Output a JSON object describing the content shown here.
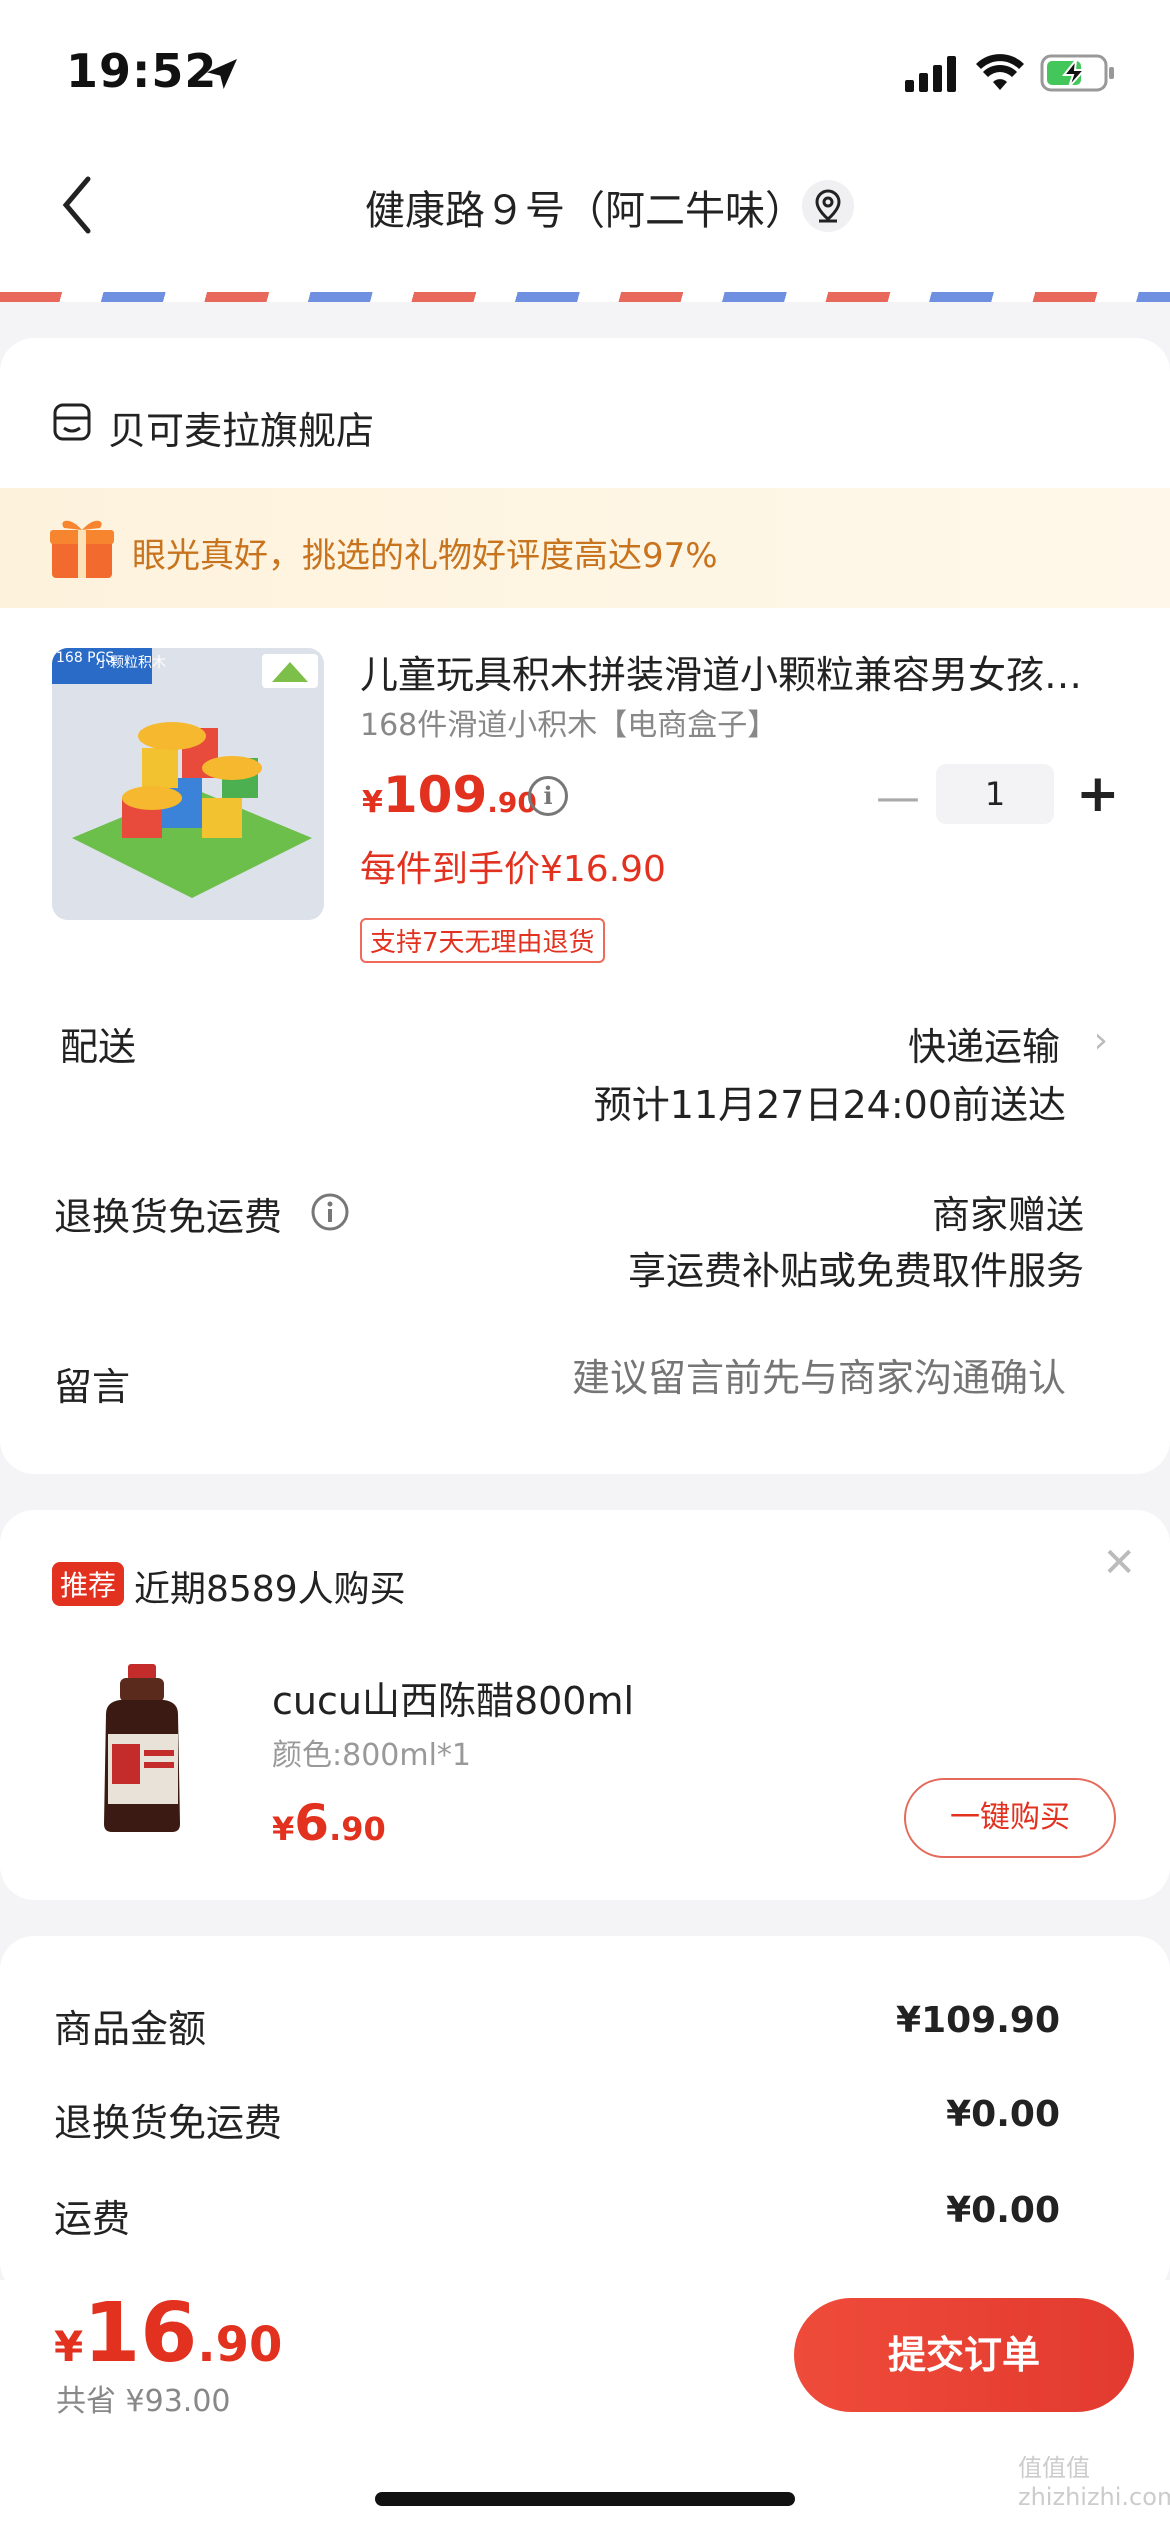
{
  "status_bar": {
    "time": "19:52"
  },
  "header": {
    "address": "健康路９号（阿二牛味）"
  },
  "shop": {
    "name": "贝可麦拉旗舰店"
  },
  "gift_banner": {
    "text": "眼光真好，挑选的礼物好评度高达97%"
  },
  "product": {
    "title": "儿童玩具积木拼装滑道小颗粒兼容男女孩…",
    "sku": "168件滑道小积木【电商盒子】",
    "price_symbol": "¥",
    "price_int": "109",
    "price_dec": ".90",
    "quantity": "1",
    "each_price": "每件到手价¥16.90",
    "return_tag": "支持7天无理由退货",
    "thumb_badge": "168 PCS",
    "thumb_label": "小颗粒积木"
  },
  "shipping": {
    "label": "配送",
    "method": "快递运输",
    "eta": "预计11月27日24:00前送达"
  },
  "return_free": {
    "label": "退换货免运费",
    "value1": "商家赠送",
    "value2": "享运费补贴或免费取件服务"
  },
  "message": {
    "label": "留言",
    "placeholder": "建议留言前先与商家沟通确认"
  },
  "recommend": {
    "badge": "推荐",
    "text": "近期8589人购买",
    "name": "cucu山西陈醋800ml",
    "sku": "颜色:800ml*1",
    "price_symbol": "¥",
    "price_int": "6",
    "price_dec": ".90",
    "buy_label": "一键购买"
  },
  "summary": [
    {
      "label": "商品金额",
      "value": "¥109.90"
    },
    {
      "label": "退换货免运费",
      "value": "¥0.00"
    },
    {
      "label": "运费",
      "value": "¥0.00"
    }
  ],
  "footer": {
    "total_symbol": "¥",
    "total_int": "16",
    "total_dec": ".90",
    "saved": "共省 ¥93.00",
    "submit_label": "提交订单"
  },
  "watermark": "值值值 zhizhizhi.com",
  "colors": {
    "accent": "#e2321f",
    "gift_text": "#c8731d"
  }
}
